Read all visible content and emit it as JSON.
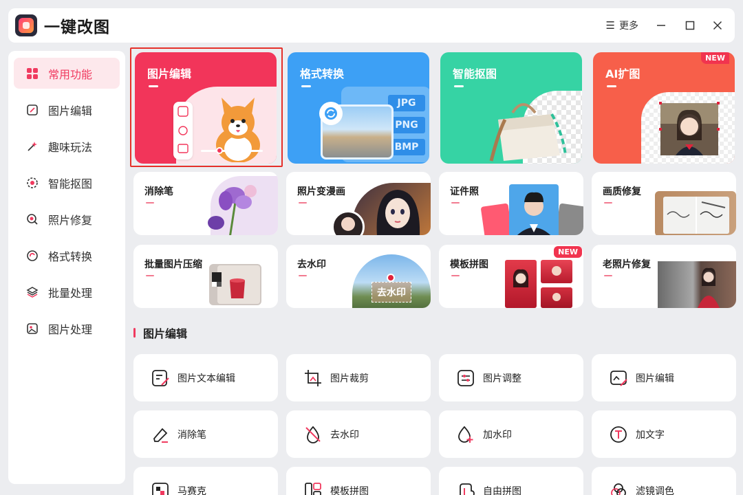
{
  "app": {
    "title": "一键改图",
    "more_label": "更多"
  },
  "window": {
    "minimize": "—",
    "maximize": "☐",
    "close": "✕"
  },
  "sidebar": {
    "items": [
      {
        "label": "常用功能",
        "active": true
      },
      {
        "label": "图片编辑"
      },
      {
        "label": "趣味玩法"
      },
      {
        "label": "智能抠图"
      },
      {
        "label": "照片修复"
      },
      {
        "label": "格式转换"
      },
      {
        "label": "批量处理"
      },
      {
        "label": "图片处理"
      }
    ]
  },
  "hero_cards": [
    {
      "title": "图片编辑",
      "color": "#f2355a",
      "selected": true
    },
    {
      "title": "格式转换",
      "color": "#3da0f5",
      "formats": [
        "JPG",
        "PNG",
        "BMP"
      ]
    },
    {
      "title": "智能抠图",
      "color": "#36d3a4"
    },
    {
      "title": "AI扩图",
      "color": "#f75f4a",
      "badge": "NEW"
    }
  ],
  "feature_cards": [
    {
      "title": "消除笔"
    },
    {
      "title": "照片变漫画"
    },
    {
      "title": "证件照"
    },
    {
      "title": "画质修复"
    },
    {
      "title": "批量图片压缩"
    },
    {
      "title": "去水印",
      "overlay": "去水印"
    },
    {
      "title": "模板拼图",
      "badge": "NEW"
    },
    {
      "title": "老照片修复"
    }
  ],
  "section": {
    "title": "图片编辑"
  },
  "tools": [
    {
      "label": "图片文本编辑",
      "icon": "text-edit-icon"
    },
    {
      "label": "图片裁剪",
      "icon": "crop-icon"
    },
    {
      "label": "图片调整",
      "icon": "adjust-icon"
    },
    {
      "label": "图片编辑",
      "icon": "image-edit-icon"
    },
    {
      "label": "消除笔",
      "icon": "eraser-icon"
    },
    {
      "label": "去水印",
      "icon": "remove-watermark-icon"
    },
    {
      "label": "加水印",
      "icon": "add-watermark-icon"
    },
    {
      "label": "加文字",
      "icon": "add-text-icon"
    },
    {
      "label": "马赛克",
      "icon": "mosaic-icon"
    },
    {
      "label": "模板拼图",
      "icon": "template-collage-icon"
    },
    {
      "label": "自由拼图",
      "icon": "free-collage-icon"
    },
    {
      "label": "滤镜调色",
      "icon": "filter-icon"
    }
  ],
  "colors": {
    "accent": "#f03a5f",
    "sidebar_active_bg": "#fde8ec",
    "badge": "#f1344f"
  }
}
